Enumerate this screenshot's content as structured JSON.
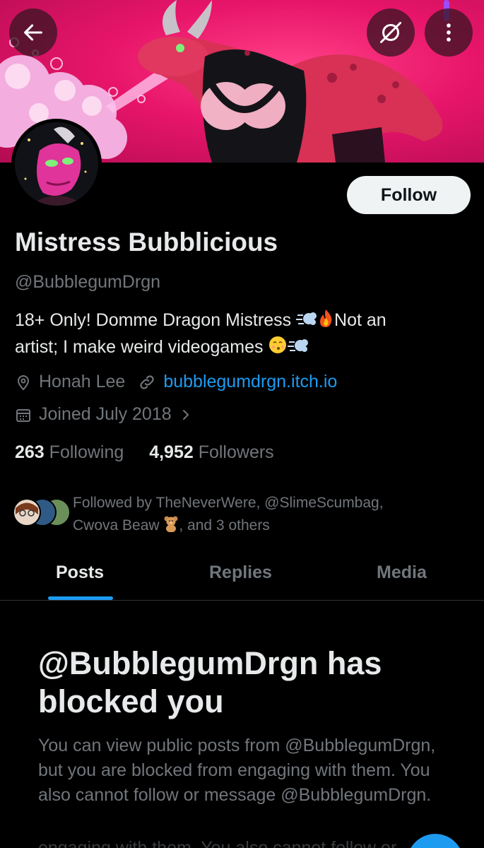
{
  "header": {
    "back_icon": "arrow-left-icon",
    "hide_icon": "eye-slash-icon",
    "more_icon": "more-vertical-icon"
  },
  "profile": {
    "display_name": "Mistress Bubblicious",
    "handle": "@BubblegumDrgn",
    "follow_label": "Follow",
    "bio_line1_text": "18+ Only! Domme Dragon Mistress ",
    "bio_line1_after": "Not an",
    "bio_line2_text": "artist; I make weird videogames ",
    "location": "Honah Lee",
    "website": "bubblegumdrgn.itch.io",
    "joined": "Joined July 2018",
    "following_count": "263",
    "following_label": "Following",
    "followers_count": "4,952",
    "followers_label": "Followers"
  },
  "followed_by": {
    "line1": "Followed by TheNeverWere, @SlimeScumbag,",
    "line2_before": "Cwova Beaw ",
    "line2_after": ", and 3 others"
  },
  "tabs": [
    {
      "label": "Posts",
      "active": true
    },
    {
      "label": "Replies",
      "active": false
    },
    {
      "label": "Media",
      "active": false
    }
  ],
  "blocked": {
    "title": "@BubblegumDrgn has blocked you",
    "body": "You can view public posts from @BubblegumDrgn, but you are blocked from engaging with them. You also cannot follow or message @BubblegumDrgn.",
    "ghost": "engaging with them. You also cannot follow or"
  },
  "colors": {
    "accent": "#1d9bf0",
    "banner_pink": "#e8156a",
    "text_primary": "#e7e9ea",
    "text_secondary": "#71767b"
  }
}
